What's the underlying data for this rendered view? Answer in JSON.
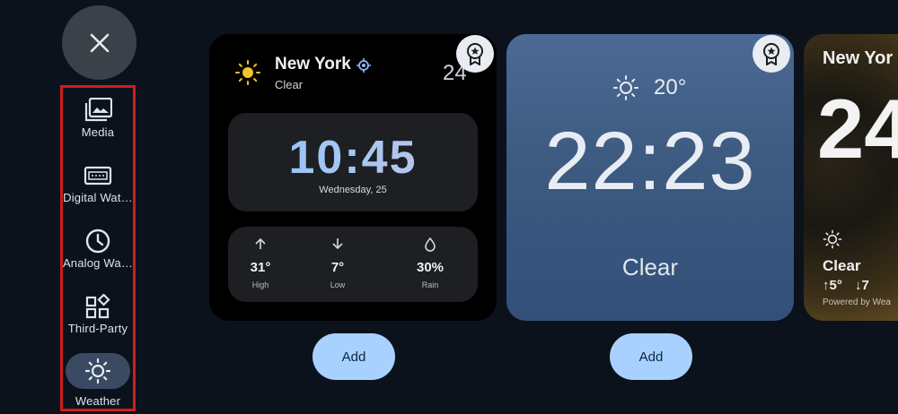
{
  "sidebar": {
    "items": [
      {
        "label": "Media",
        "icon": "photo-library-icon"
      },
      {
        "label": "Digital Wat…",
        "icon": "digital-watch-icon"
      },
      {
        "label": "Analog Wa…",
        "icon": "clock-icon"
      },
      {
        "label": "Third-Party",
        "icon": "widgets-icon"
      },
      {
        "label": "Weather",
        "icon": "sun-icon",
        "selected": true
      }
    ]
  },
  "cards": [
    {
      "city": "New York",
      "condition": "Clear",
      "temp": "24",
      "time": "10:45",
      "date": "Wednesday, 25",
      "stats": [
        {
          "value": "31°",
          "label": "High"
        },
        {
          "value": "7°",
          "label": "Low"
        },
        {
          "value": "30%",
          "label": "Rain"
        }
      ],
      "add_label": "Add"
    },
    {
      "temp": "20°",
      "time": "22:23",
      "condition": "Clear",
      "add_label": "Add"
    },
    {
      "city": "New Yor",
      "temp_big": "24",
      "condition": "Clear",
      "high": "5°",
      "low": "7",
      "footer": "Powered by Wea"
    }
  ],
  "colors": {
    "accent": "#a8d1ff",
    "highlight": "#d01d1d",
    "selected_pill": "#3a4a63"
  }
}
